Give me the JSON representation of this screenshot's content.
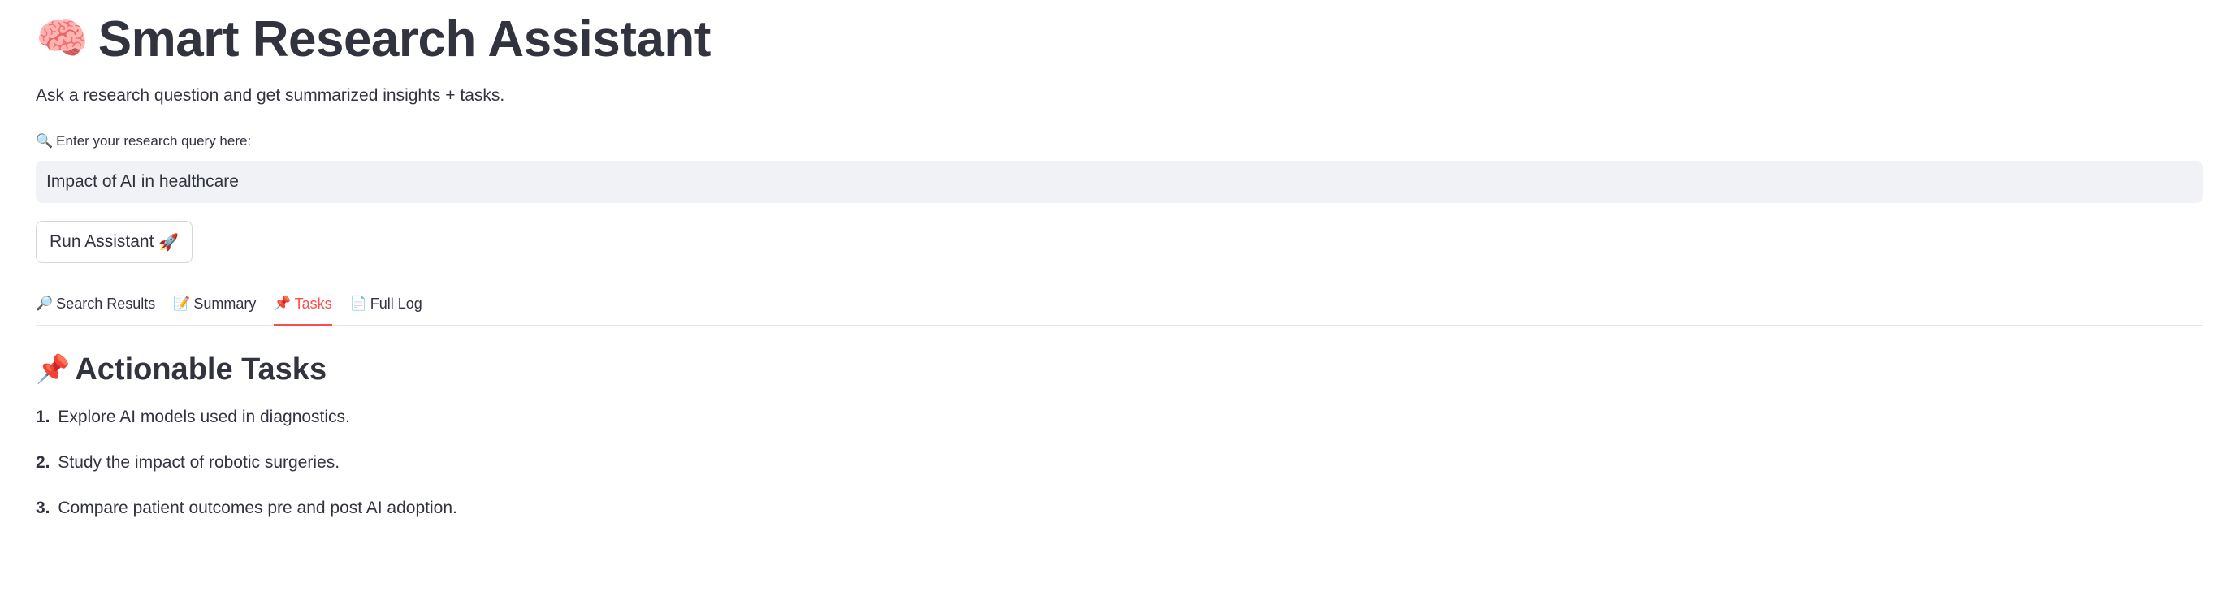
{
  "header": {
    "title_icon": "🧠",
    "title": "Smart Research Assistant",
    "subtitle": "Ask a research question and get summarized insights + tasks."
  },
  "query": {
    "label_icon": "🔍",
    "label": "Enter your research query here:",
    "value": "Impact of AI in healthcare"
  },
  "run_button": {
    "label": "Run Assistant",
    "icon": "🚀"
  },
  "tabs": [
    {
      "icon": "🔎",
      "label": "Search Results",
      "active": false
    },
    {
      "icon": "📝",
      "label": "Summary",
      "active": false
    },
    {
      "icon": "📌",
      "label": "Tasks",
      "active": true
    },
    {
      "icon": "📄",
      "label": "Full Log",
      "active": false
    }
  ],
  "tasks_section": {
    "icon": "📌",
    "heading": "Actionable Tasks",
    "items": [
      {
        "num": "1.",
        "text": "Explore AI models used in diagnostics."
      },
      {
        "num": "2.",
        "text": "Study the impact of robotic surgeries."
      },
      {
        "num": "3.",
        "text": "Compare patient outcomes pre and post AI adoption."
      }
    ]
  },
  "colors": {
    "accent": "#ff4b4b",
    "text": "#31333f",
    "input_bg": "#f0f2f6",
    "divider": "#e6e6ea"
  }
}
